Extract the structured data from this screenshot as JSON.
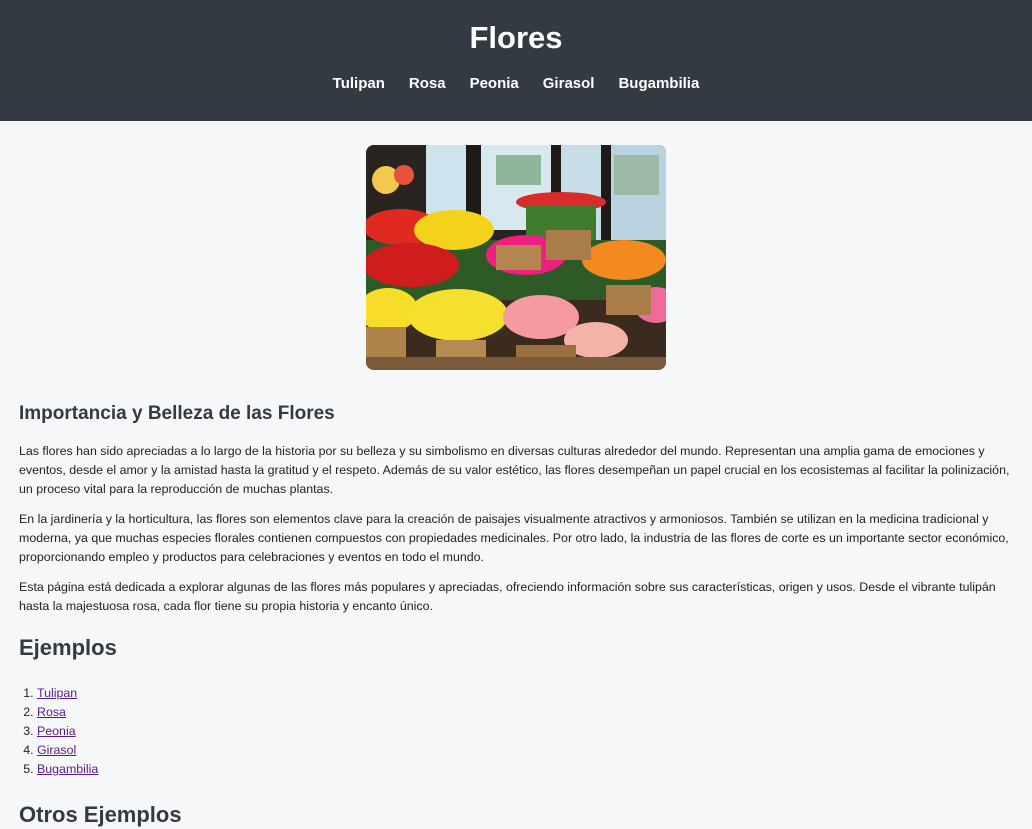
{
  "header": {
    "title": "Flores",
    "nav": [
      "Tulipan",
      "Rosa",
      "Peonia",
      "Girasol",
      "Bugambilia"
    ]
  },
  "hero": {
    "alt": "Flores en cestas en una florería"
  },
  "section": {
    "title": "Importancia y Belleza de las Flores",
    "paragraphs": [
      "Las flores han sido apreciadas a lo largo de la historia por su belleza y su simbolismo en diversas culturas alrededor del mundo. Representan una amplia gama de emociones y eventos, desde el amor y la amistad hasta la gratitud y el respeto. Además de su valor estético, las flores desempeñan un papel crucial en los ecosistemas al facilitar la polinización, un proceso vital para la reproducción de muchas plantas.",
      "En la jardinería y la horticultura, las flores son elementos clave para la creación de paisajes visualmente atractivos y armoniosos. También se utilizan en la medicina tradicional y moderna, ya que muchas especies florales contienen compuestos con propiedades medicinales. Por otro lado, la industria de las flores de corte es un importante sector económico, proporcionando empleo y productos para celebraciones y eventos en todo el mundo.",
      "Esta página está dedicada a explorar algunas de las flores más populares y apreciadas, ofreciendo información sobre sus características, origen y usos. Desde el vibrante tulipán hasta la majestuosa rosa, cada flor tiene su propia historia y encanto único."
    ]
  },
  "examples": {
    "title": "Ejemplos",
    "items": [
      "Tulipan",
      "Rosa",
      "Peonia",
      "Girasol",
      "Bugambilia"
    ]
  },
  "other": {
    "title": "Otros Ejemplos"
  },
  "colors": {
    "header_bg": "#333a42",
    "page_bg": "#f6f7f9",
    "link": "#5a1a8c"
  }
}
